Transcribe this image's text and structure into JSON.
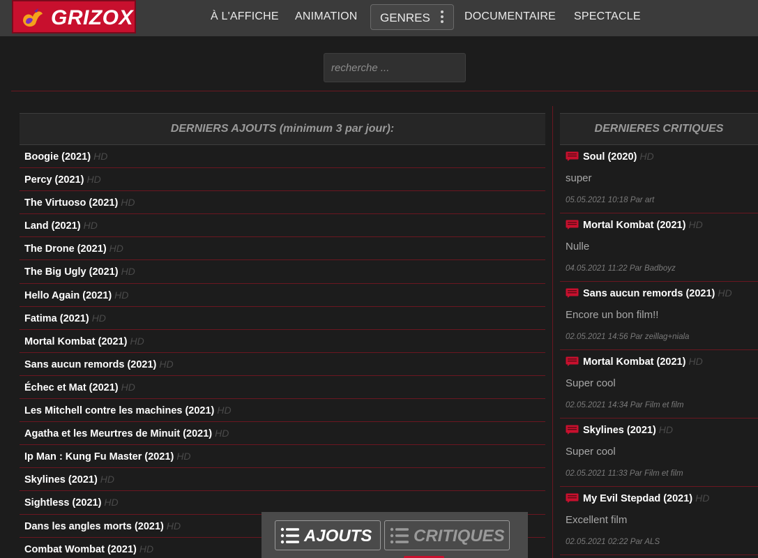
{
  "header": {
    "logo_text": "GRIZOX",
    "nav": [
      {
        "label": "À L'AFFICHE"
      },
      {
        "label": "ANIMATION"
      },
      {
        "label": "GENRES"
      },
      {
        "label": "DOCUMENTAIRE"
      },
      {
        "label": "SPECTACLE"
      }
    ]
  },
  "search": {
    "placeholder": "recherche ..."
  },
  "latest": {
    "title": "DERNIERS AJOUTS (minimum 3 par jour):",
    "badge": "HD",
    "films": [
      "Boogie (2021)",
      "Percy (2021)",
      "The Virtuoso (2021)",
      "Land (2021)",
      "The Drone (2021)",
      "The Big Ugly (2021)",
      "Hello Again (2021)",
      "Fatima (2021)",
      "Mortal Kombat (2021)",
      "Sans aucun remords (2021)",
      "Échec et Mat (2021)",
      "Les Mitchell contre les machines (2021)",
      "Agatha et les Meurtres de Minuit (2021)",
      "Ip Man : Kung Fu Master (2021)",
      "Skylines (2021)",
      "Sightless (2021)",
      "Dans les angles morts (2021)",
      "Combat Wombat (2021)"
    ]
  },
  "reviews": {
    "title": "DERNIERES CRITIQUES",
    "badge": "HD",
    "items": [
      {
        "film": "Soul (2020)",
        "text": "super",
        "meta": "05.05.2021 10:18 Par art"
      },
      {
        "film": "Mortal Kombat (2021)",
        "text": "Nulle",
        "meta": "04.05.2021 11:22 Par Badboyz"
      },
      {
        "film": "Sans aucun remords (2021)",
        "text": "Encore un bon film!!",
        "meta": "02.05.2021 14:56 Par zeillag+niala"
      },
      {
        "film": "Mortal Kombat (2021)",
        "text": "Super cool",
        "meta": "02.05.2021 14:34 Par Film et film"
      },
      {
        "film": "Skylines (2021)",
        "text": "Super cool",
        "meta": "02.05.2021 11:33 Par Film et film"
      },
      {
        "film": "My Evil Stepdad (2021)",
        "text": "Excellent film",
        "meta": "02.05.2021 02:22 Par ALS"
      }
    ]
  },
  "bottom_tabs": {
    "ajouts": "AJOUTS",
    "critiques": "CRITIQUES"
  },
  "colors": {
    "brand_red": "#c8102e",
    "background": "#1c1c1c",
    "topbar": "#3b3b3b",
    "divider": "#6b1620"
  }
}
